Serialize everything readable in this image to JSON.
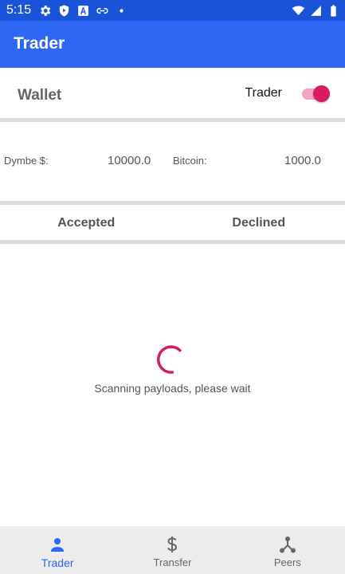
{
  "status_bar": {
    "time": "5:15",
    "left_icons": [
      "gear-icon",
      "play-protect-icon",
      "font-a-icon",
      "link-icon",
      "dot-icon"
    ],
    "right_icons": [
      "wifi-icon",
      "signal-icon",
      "battery-icon"
    ]
  },
  "app_bar": {
    "title": "Trader"
  },
  "wallet": {
    "label": "Wallet",
    "switch_label": "Trader",
    "switch_on": true
  },
  "balances": [
    {
      "label": "Dymbe $:",
      "value": "10000.0"
    },
    {
      "label": "Bitcoin:",
      "value": "1000.0"
    }
  ],
  "tabs": [
    {
      "label": "Accepted"
    },
    {
      "label": "Declined"
    }
  ],
  "loading": {
    "message": "Scanning payloads, please wait"
  },
  "bottom_nav": {
    "items": [
      {
        "label": "Trader",
        "icon": "person-icon",
        "active": true
      },
      {
        "label": "Transfer",
        "icon": "dollar-icon",
        "active": false
      },
      {
        "label": "Peers",
        "icon": "network-icon",
        "active": false
      }
    ]
  },
  "colors": {
    "status_bar": "#1b53d8",
    "app_bar": "#2f67f5",
    "accent": "#d81b60",
    "nav_active": "#2f67f5",
    "nav_background": "#ececec"
  }
}
